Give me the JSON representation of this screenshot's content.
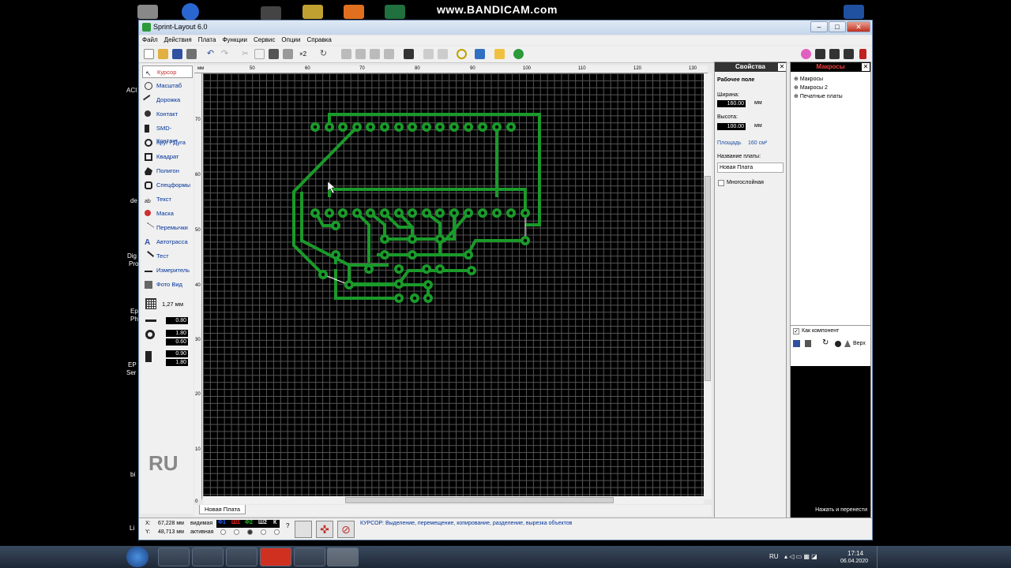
{
  "watermark": "www.BANDICAM.com",
  "desktop": {
    "labels": [
      "ACI",
      "de",
      "Dig",
      "Pro",
      "Ep",
      "Ph",
      "EP",
      "Ser",
      "bi",
      "Li"
    ],
    "ru_badge": "RU"
  },
  "window": {
    "title": "Sprint-Layout 6.0",
    "controls": {
      "minimize": "–",
      "maximize": "□",
      "close": "✕"
    }
  },
  "menu": [
    "Файл",
    "Действия",
    "Плата",
    "Функции",
    "Сервис",
    "Опции",
    "Справка"
  ],
  "toolbar": {
    "zoom_label": "×2"
  },
  "tools": [
    {
      "label": "Курсор",
      "icon": "cursor-icon"
    },
    {
      "label": "Масштаб",
      "icon": "zoom-icon"
    },
    {
      "label": "Дорожка",
      "icon": "track-icon"
    },
    {
      "label": "Контакт",
      "icon": "pad-icon"
    },
    {
      "label": "SMD-Контакт",
      "icon": "smd-icon"
    },
    {
      "label": "Круг / Дуга",
      "icon": "circle-icon"
    },
    {
      "label": "Квадрат",
      "icon": "square-icon"
    },
    {
      "label": "Полигон",
      "icon": "polygon-icon"
    },
    {
      "label": "Спецформы",
      "icon": "shapes-icon"
    },
    {
      "label": "Текст",
      "icon": "text-icon"
    },
    {
      "label": "Маска",
      "icon": "mask-icon"
    },
    {
      "label": "Перемычки",
      "icon": "jumper-icon"
    },
    {
      "label": "Автотрасса",
      "icon": "autoroute-icon"
    },
    {
      "label": "Тест",
      "icon": "test-icon"
    },
    {
      "label": "Измеритель",
      "icon": "measure-icon"
    },
    {
      "label": "Фото Вид",
      "icon": "photo-icon"
    }
  ],
  "grid": {
    "label": "1,27 мм"
  },
  "params": {
    "track_width": "0.80",
    "pad_outer": "1.80",
    "pad_inner": "0.60",
    "smd_w": "0.90",
    "smd_h": "1.80"
  },
  "ruler": {
    "unit": "мм",
    "top_ticks": [
      "50",
      "60",
      "70",
      "80",
      "90",
      "100",
      "110",
      "120",
      "130"
    ],
    "left_ticks": [
      "70",
      "60",
      "50",
      "40",
      "30",
      "20",
      "10",
      "0"
    ]
  },
  "tabs": [
    "Новая Плата"
  ],
  "properties": {
    "header": "Свойства",
    "section": "Рабочее поле",
    "width_label": "Ширина:",
    "width_value": "160.00",
    "height_label": "Высота:",
    "height_value": "100.00",
    "unit": "мм",
    "area_label": "Площадь",
    "area_value": "160 см²",
    "name_label": "Название платы:",
    "name_value": "Новая Плата",
    "multilayer_label": "Многослойная"
  },
  "macros": {
    "header": "Макросы",
    "tree": [
      "Макросы",
      "Макросы 2",
      "Печатные платы"
    ],
    "as_component": "Как компонент",
    "top_label": "Верх",
    "hint": "Нажать и перенести"
  },
  "status": {
    "x_label": "X:",
    "x_value": "67,228 мм",
    "y_label": "Y:",
    "y_value": "48,713 мм",
    "visible_label": "видимая",
    "active_label": "активная",
    "layers": [
      "Ф1",
      "Ш1",
      "Ф2",
      "Ш2",
      "К"
    ],
    "layer_colors": [
      "#2060ff",
      "#ff2020",
      "#20c020",
      "#f0f0f0",
      "#ffffff"
    ],
    "help": "?",
    "message": "КУРСОР: Выделение, перемещение, копирование, разделение, вырезка объектов"
  },
  "taskbar": {
    "lang": "RU",
    "time": "17:14",
    "date": "06.04.2020"
  },
  "colors": {
    "copper": "#1a9a2a",
    "canvas_bg": "#000000",
    "grid": "#555555"
  }
}
